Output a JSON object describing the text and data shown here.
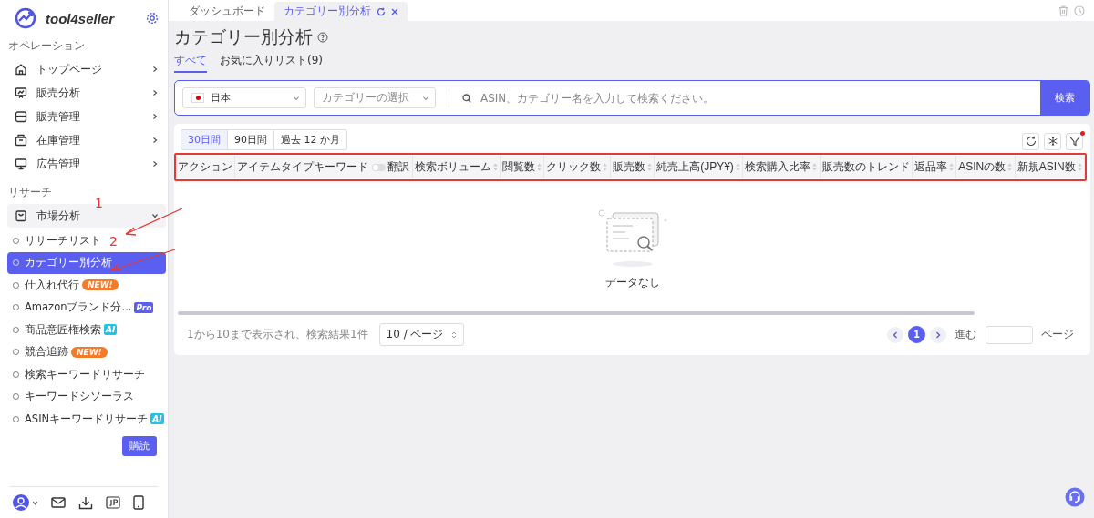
{
  "sidebar": {
    "brand": "tool4seller",
    "sections": [
      {
        "title": "オペレーション",
        "items": [
          {
            "label": "トップページ",
            "expanded": false
          },
          {
            "label": "販売分析",
            "expanded": false
          },
          {
            "label": "販売管理",
            "expanded": false
          },
          {
            "label": "在庫管理",
            "expanded": false
          },
          {
            "label": "広告管理",
            "expanded": false
          }
        ]
      },
      {
        "title": "リサーチ",
        "items": [
          {
            "label": "市場分析",
            "expanded": true,
            "children": [
              {
                "label": "リサーチリスト",
                "selected": false
              },
              {
                "label": "カテゴリー別分析",
                "selected": true
              },
              {
                "label": "仕入れ代行",
                "selected": false,
                "badge": {
                  "text": "NEW!",
                  "kind": "new"
                }
              },
              {
                "label": "Amazonブランド分...",
                "selected": false,
                "badge": {
                  "text": "Pro",
                  "kind": "pro"
                }
              },
              {
                "label": "商品意匠権検索",
                "selected": false,
                "badge": {
                  "text": "AI",
                  "kind": "ai"
                }
              },
              {
                "label": "競合追跡",
                "selected": false,
                "badge": {
                  "text": "NEW!",
                  "kind": "new"
                }
              },
              {
                "label": "検索キーワードリサーチ",
                "selected": false
              },
              {
                "label": "キーワードシソーラス",
                "selected": false
              },
              {
                "label": "ASINキーワードリサーチ",
                "selected": false,
                "badge": {
                  "text": "AI",
                  "kind": "ai"
                }
              }
            ]
          }
        ]
      }
    ],
    "subscribe_button": "購読"
  },
  "tabs": [
    {
      "label": "ダッシュボード",
      "selected": false
    },
    {
      "label": "カテゴリー別分析",
      "selected": true
    }
  ],
  "page": {
    "title": "カテゴリー別分析",
    "subtabs": [
      {
        "label": "すべて",
        "selected": true
      },
      {
        "label": "お気に入りリスト(9)",
        "selected": false
      }
    ],
    "search": {
      "country": "日本",
      "category_placeholder": "カテゴリーの選択",
      "placeholder": "ASIN、カテゴリー名を入力して検索ください。",
      "button": "検索"
    },
    "periods": [
      {
        "label": "30日間",
        "selected": true
      },
      {
        "label": "90日間",
        "selected": false
      },
      {
        "label": "過去 12 か月",
        "selected": false
      }
    ],
    "filter_badge": true,
    "translate_toggle": {
      "label": "翻訳",
      "on": false
    },
    "columns": [
      {
        "label": "アクション",
        "sortable": false
      },
      {
        "label": "アイテムタイプキーワード",
        "sortable": false,
        "kind": "toggle"
      },
      {
        "label": "検索ボリューム",
        "sortable": true
      },
      {
        "label": "閲覧数",
        "sortable": true
      },
      {
        "label": "クリック数",
        "sortable": true
      },
      {
        "label": "販売数",
        "sortable": true
      },
      {
        "label": "純売上高(JPY¥)",
        "sortable": true
      },
      {
        "label": "検索購入比率",
        "sortable": true
      },
      {
        "label": "販売数のトレンド",
        "sortable": false
      },
      {
        "label": "返品率",
        "sortable": true
      },
      {
        "label": "ASINの数",
        "sortable": true
      },
      {
        "label": "新規ASIN数",
        "sortable": true
      }
    ],
    "empty_text": "データなし",
    "pagination": {
      "summary": "1から10まで表示され、検索結果1件",
      "page_size": "10 / ページ",
      "pages": [
        {
          "label": "1",
          "selected": true
        }
      ],
      "goto_label": "進む",
      "goto_suffix": "ページ"
    }
  },
  "annotations": [
    {
      "label": "1"
    },
    {
      "label": "2"
    }
  ]
}
